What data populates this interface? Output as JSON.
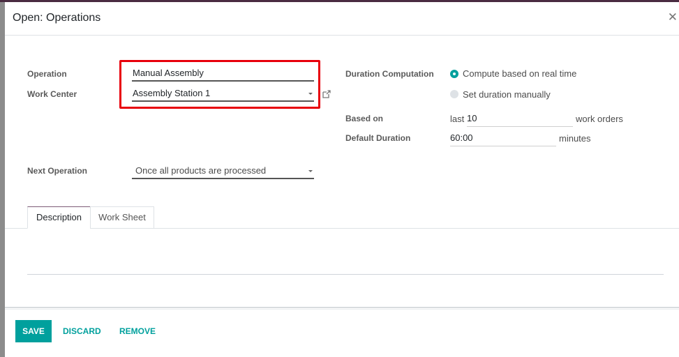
{
  "dialog": {
    "title": "Open: Operations",
    "close_icon": "close-icon"
  },
  "form": {
    "operation": {
      "label": "Operation",
      "value": "Manual Assembly"
    },
    "work_center": {
      "label": "Work Center",
      "value": "Assembly Station 1",
      "external_link_icon": "external-link-icon"
    },
    "next_operation": {
      "label": "Next Operation",
      "value": "Once all products are processed"
    },
    "duration_computation": {
      "label": "Duration Computation",
      "options": [
        {
          "label": "Compute based on real time",
          "selected": true
        },
        {
          "label": "Set duration manually",
          "selected": false
        }
      ]
    },
    "based_on": {
      "label": "Based on",
      "prefix": "last",
      "value": "10",
      "suffix": "work orders"
    },
    "default_duration": {
      "label": "Default Duration",
      "value": "60:00",
      "suffix": "minutes"
    }
  },
  "tabs": [
    {
      "label": "Description",
      "active": true
    },
    {
      "label": "Work Sheet",
      "active": false
    }
  ],
  "footer": {
    "save_label": "SAVE",
    "discard_label": "DISCARD",
    "remove_label": "REMOVE"
  },
  "colors": {
    "accent": "#00a09d",
    "highlight": "#e8000b",
    "topbar": "#4a2b41"
  }
}
